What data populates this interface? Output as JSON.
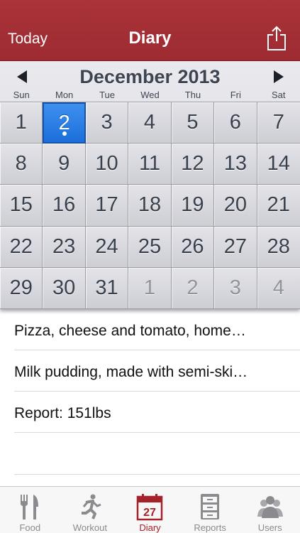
{
  "header": {
    "left_button": "Today",
    "title": "Diary",
    "share_icon": "share-icon"
  },
  "calendar": {
    "month_label": "December 2013",
    "weekdays": [
      "Sun",
      "Mon",
      "Tue",
      "Wed",
      "Thu",
      "Fri",
      "Sat"
    ],
    "days": [
      {
        "n": "1",
        "other": false
      },
      {
        "n": "2",
        "other": false,
        "selected": true,
        "has_entries": true
      },
      {
        "n": "3",
        "other": false
      },
      {
        "n": "4",
        "other": false
      },
      {
        "n": "5",
        "other": false
      },
      {
        "n": "6",
        "other": false
      },
      {
        "n": "7",
        "other": false
      },
      {
        "n": "8",
        "other": false
      },
      {
        "n": "9",
        "other": false
      },
      {
        "n": "10",
        "other": false
      },
      {
        "n": "11",
        "other": false
      },
      {
        "n": "12",
        "other": false
      },
      {
        "n": "13",
        "other": false
      },
      {
        "n": "14",
        "other": false
      },
      {
        "n": "15",
        "other": false
      },
      {
        "n": "16",
        "other": false
      },
      {
        "n": "17",
        "other": false
      },
      {
        "n": "18",
        "other": false
      },
      {
        "n": "19",
        "other": false
      },
      {
        "n": "20",
        "other": false
      },
      {
        "n": "21",
        "other": false
      },
      {
        "n": "22",
        "other": false
      },
      {
        "n": "23",
        "other": false
      },
      {
        "n": "24",
        "other": false
      },
      {
        "n": "25",
        "other": false
      },
      {
        "n": "26",
        "other": false
      },
      {
        "n": "27",
        "other": false
      },
      {
        "n": "28",
        "other": false
      },
      {
        "n": "29",
        "other": false
      },
      {
        "n": "30",
        "other": false
      },
      {
        "n": "31",
        "other": false
      },
      {
        "n": "1",
        "other": true
      },
      {
        "n": "2",
        "other": true
      },
      {
        "n": "3",
        "other": true
      },
      {
        "n": "4",
        "other": true
      }
    ]
  },
  "entries": [
    "Pizza, cheese and tomato, home…",
    "Milk pudding, made with semi-ski…",
    "Report: 151lbs"
  ],
  "tabbar": {
    "tabs": [
      {
        "label": "Food",
        "icon": "fork-knife-icon",
        "active": false
      },
      {
        "label": "Workout",
        "icon": "running-man-icon",
        "active": false
      },
      {
        "label": "Diary",
        "icon": "calendar-icon",
        "icon_text": "27",
        "active": true
      },
      {
        "label": "Reports",
        "icon": "file-cabinet-icon",
        "active": false
      },
      {
        "label": "Users",
        "icon": "users-icon",
        "active": false
      }
    ]
  },
  "colors": {
    "header_red": "#a9343a",
    "selected_blue": "#2a7fe5",
    "tab_active": "#a5222a",
    "tab_inactive": "#8b8b8f"
  }
}
